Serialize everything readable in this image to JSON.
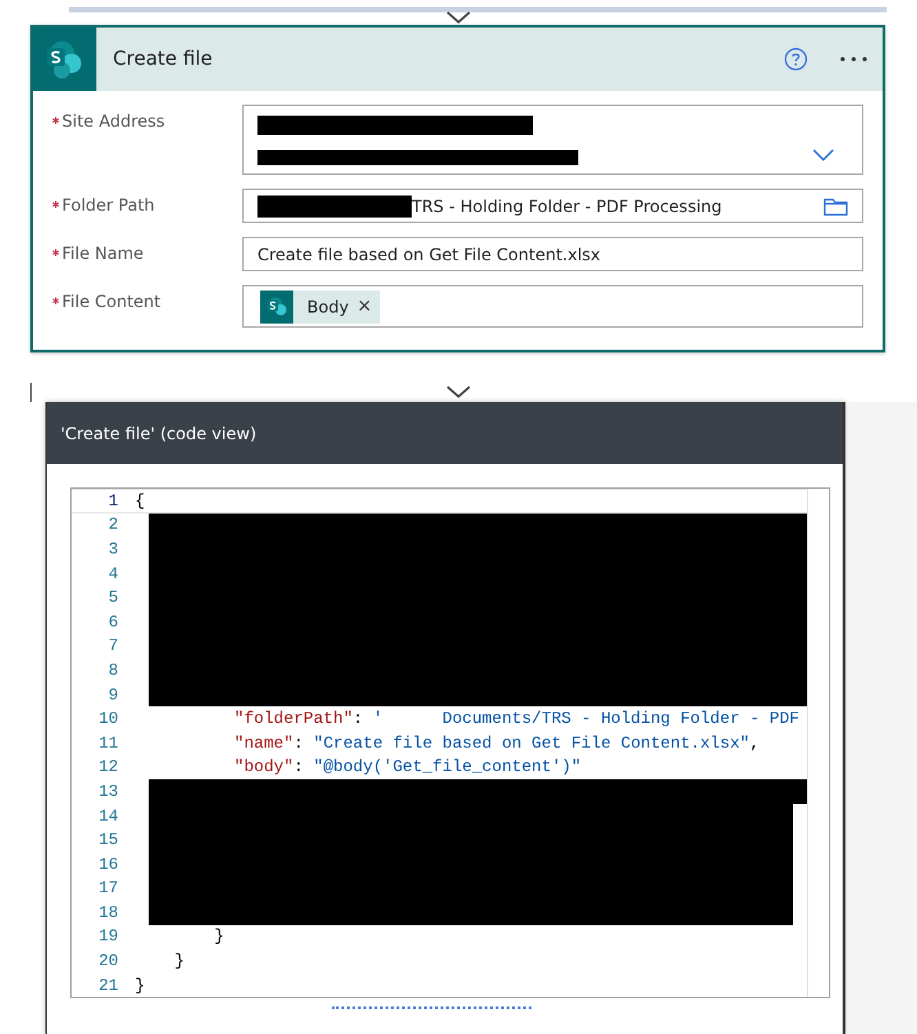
{
  "action_card": {
    "title": "Create file",
    "fields": [
      {
        "label": "Site Address",
        "required": true,
        "kind": "dropdown",
        "redacted": true
      },
      {
        "label": "Folder Path",
        "required": true,
        "kind": "folder",
        "redacted": true,
        "value": "TRS - Holding Folder - PDF Processing"
      },
      {
        "label": "File Name",
        "required": true,
        "kind": "text",
        "value": "Create file based on Get File Content.xlsx"
      },
      {
        "label": "File Content",
        "required": true,
        "kind": "tokens",
        "tokens": [
          {
            "label": "Body",
            "remove": "×"
          }
        ]
      }
    ]
  },
  "code_view": {
    "title": "'Create file' (code view)",
    "lines": [
      {
        "number": "1",
        "current": true,
        "kind": "code",
        "segments": [
          {
            "text": "{",
            "kind": "punct"
          }
        ]
      },
      {
        "number": "2",
        "current": false,
        "kind": "redacted"
      },
      {
        "number": "3",
        "current": false,
        "kind": "redacted"
      },
      {
        "number": "4",
        "current": false,
        "kind": "redacted"
      },
      {
        "number": "5",
        "current": false,
        "kind": "redacted"
      },
      {
        "number": "6",
        "current": false,
        "kind": "redacted"
      },
      {
        "number": "7",
        "current": false,
        "kind": "redacted"
      },
      {
        "number": "8",
        "current": false,
        "kind": "redacted"
      },
      {
        "number": "9",
        "current": false,
        "kind": "redacted"
      },
      {
        "number": "10",
        "current": false,
        "kind": "code",
        "segments": [
          {
            "text": "\"folderPath\"",
            "kind": "key"
          },
          {
            "text": ": ",
            "kind": "punct"
          },
          {
            "text": "'      Documents/TRS - Holding Folder - PDF",
            "kind": "string"
          }
        ]
      },
      {
        "number": "11",
        "current": false,
        "kind": "code",
        "segments": [
          {
            "text": "\"name\"",
            "kind": "key"
          },
          {
            "text": ": ",
            "kind": "punct"
          },
          {
            "text": "\"Create file based on Get File Content.xlsx\"",
            "kind": "string"
          },
          {
            "text": ",",
            "kind": "punct"
          }
        ]
      },
      {
        "number": "12",
        "current": false,
        "kind": "code",
        "segments": [
          {
            "text": "\"body\"",
            "kind": "key"
          },
          {
            "text": ": ",
            "kind": "punct"
          },
          {
            "text": "\"@body('Get_file_content')\"",
            "kind": "string"
          }
        ]
      },
      {
        "number": "13",
        "current": false,
        "kind": "redacted"
      },
      {
        "number": "14",
        "current": false,
        "kind": "redacted"
      },
      {
        "number": "15",
        "current": false,
        "kind": "redacted"
      },
      {
        "number": "16",
        "current": false,
        "kind": "redacted"
      },
      {
        "number": "17",
        "current": false,
        "kind": "redacted"
      },
      {
        "number": "18",
        "current": false,
        "kind": "redacted"
      },
      {
        "number": "19",
        "current": false,
        "kind": "code",
        "segments": [
          {
            "text": "        }",
            "kind": "punct"
          }
        ]
      },
      {
        "number": "20",
        "current": false,
        "kind": "code",
        "segments": [
          {
            "text": "    }",
            "kind": "punct"
          }
        ]
      },
      {
        "number": "21",
        "current": false,
        "kind": "code",
        "segments": [
          {
            "text": "}",
            "kind": "punct"
          }
        ]
      }
    ]
  }
}
